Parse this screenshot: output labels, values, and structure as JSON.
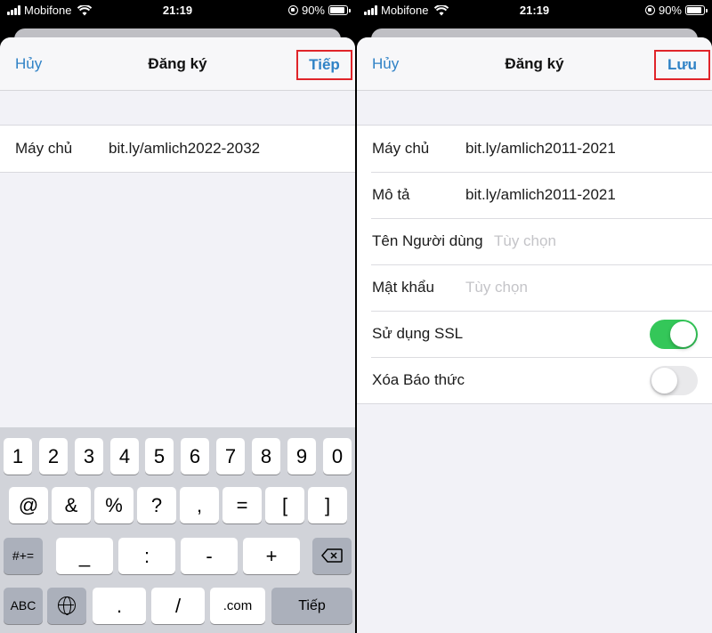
{
  "left": {
    "status": {
      "carrier": "Mobifone",
      "time": "21:19",
      "battery": "90%",
      "battery_level": 0.9
    },
    "nav": {
      "cancel": "Hủy",
      "title": "Đăng ký",
      "action": "Tiếp"
    },
    "form": {
      "server": {
        "label": "Máy chủ",
        "value": "bit.ly/amlich2022-2032"
      }
    },
    "keyboard": {
      "row1": [
        "1",
        "2",
        "3",
        "4",
        "5",
        "6",
        "7",
        "8",
        "9",
        "0"
      ],
      "row2": [
        "@",
        "&",
        "%",
        "?",
        ",",
        "=",
        "[",
        "]"
      ],
      "row3": {
        "mode": "#+=",
        "keys": [
          "_",
          ":",
          "-",
          "+"
        ]
      },
      "row4": {
        "abc": "ABC",
        "dot": ".",
        "slash": "/",
        "com": ".com",
        "next": "Tiếp"
      }
    }
  },
  "right": {
    "status": {
      "carrier": "Mobifone",
      "time": "21:19",
      "battery": "90%",
      "battery_level": 0.9
    },
    "nav": {
      "cancel": "Hủy",
      "title": "Đăng ký",
      "action": "Lưu"
    },
    "form": {
      "server": {
        "label": "Máy chủ",
        "value": "bit.ly/amlich2011-2021"
      },
      "description": {
        "label": "Mô tả",
        "value": "bit.ly/amlich2011-2021"
      },
      "username": {
        "label": "Tên Người dùng",
        "placeholder": "Tùy chọn"
      },
      "password": {
        "label": "Mật khẩu",
        "placeholder": "Tùy chọn"
      },
      "ssl": {
        "label": "Sử dụng SSL",
        "enabled": true
      },
      "remove_alarms": {
        "label": "Xóa Báo thức",
        "enabled": false
      }
    }
  },
  "colors": {
    "accent": "#2f82c6",
    "highlight_border": "#e0242a",
    "toggle_on": "#34c759"
  }
}
